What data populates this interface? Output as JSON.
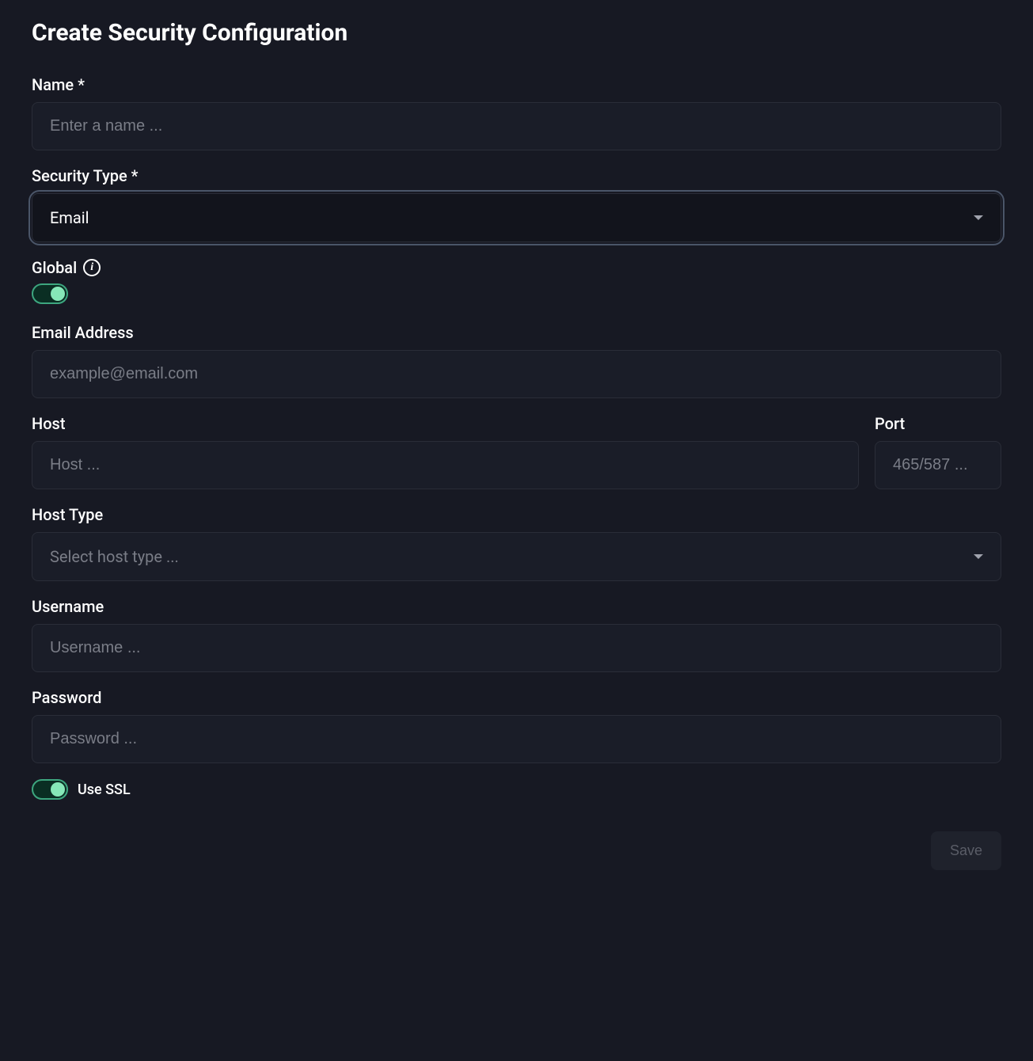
{
  "title": "Create Security Configuration",
  "fields": {
    "name": {
      "label": "Name *",
      "placeholder": "Enter a name ..."
    },
    "security_type": {
      "label": "Security Type *",
      "value": "Email"
    },
    "global": {
      "label": "Global",
      "on": true
    },
    "email_address": {
      "label": "Email Address",
      "placeholder": "example@email.com"
    },
    "host": {
      "label": "Host",
      "placeholder": "Host ..."
    },
    "port": {
      "label": "Port",
      "placeholder": "465/587 ..."
    },
    "host_type": {
      "label": "Host Type",
      "placeholder": "Select host type ..."
    },
    "username": {
      "label": "Username",
      "placeholder": "Username ..."
    },
    "password": {
      "label": "Password",
      "placeholder": "Password ..."
    },
    "use_ssl": {
      "label": "Use SSL",
      "on": true
    }
  },
  "buttons": {
    "save": "Save"
  }
}
